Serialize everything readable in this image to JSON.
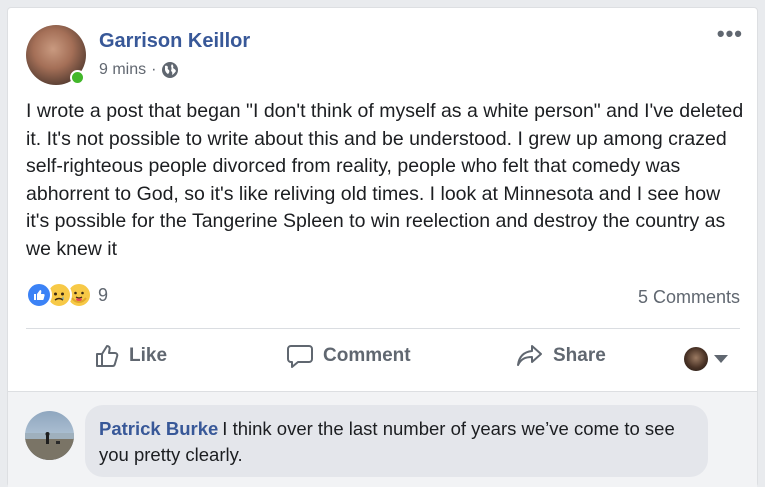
{
  "post": {
    "author": "Garrison Keillor",
    "time": "9 mins",
    "separator": "·",
    "text": "I wrote a post that began \"I don't think of myself as a white person\" and I've deleted it. It's not possible to write about this and be understood. I grew up among crazed self-righteous people divorced from reality, people who felt that comedy was abhorrent to God, so it's like reliving old times. I look at Minnesota and I see how it's possible for the Tangerine Spleen to win reelection and destroy the country as we knew it",
    "reaction_count": "9",
    "comments_count": "5 Comments",
    "more_glyph": "•••"
  },
  "actions": {
    "like": "Like",
    "comment": "Comment",
    "share": "Share"
  },
  "comment": {
    "author": "Patrick Burke",
    "text": "I think over the last number of years we’ve come to see you pretty clearly."
  },
  "colors": {
    "link": "#385898",
    "online": "#42b72a",
    "like_blue": "#3b82f6",
    "emoji_yellow": "#f7c947"
  },
  "icons": {
    "reactions": [
      "like-reaction-icon",
      "sad-reaction-icon",
      "care-reaction-icon"
    ],
    "privacy": "globe-icon",
    "menu": "more-options-icon"
  }
}
